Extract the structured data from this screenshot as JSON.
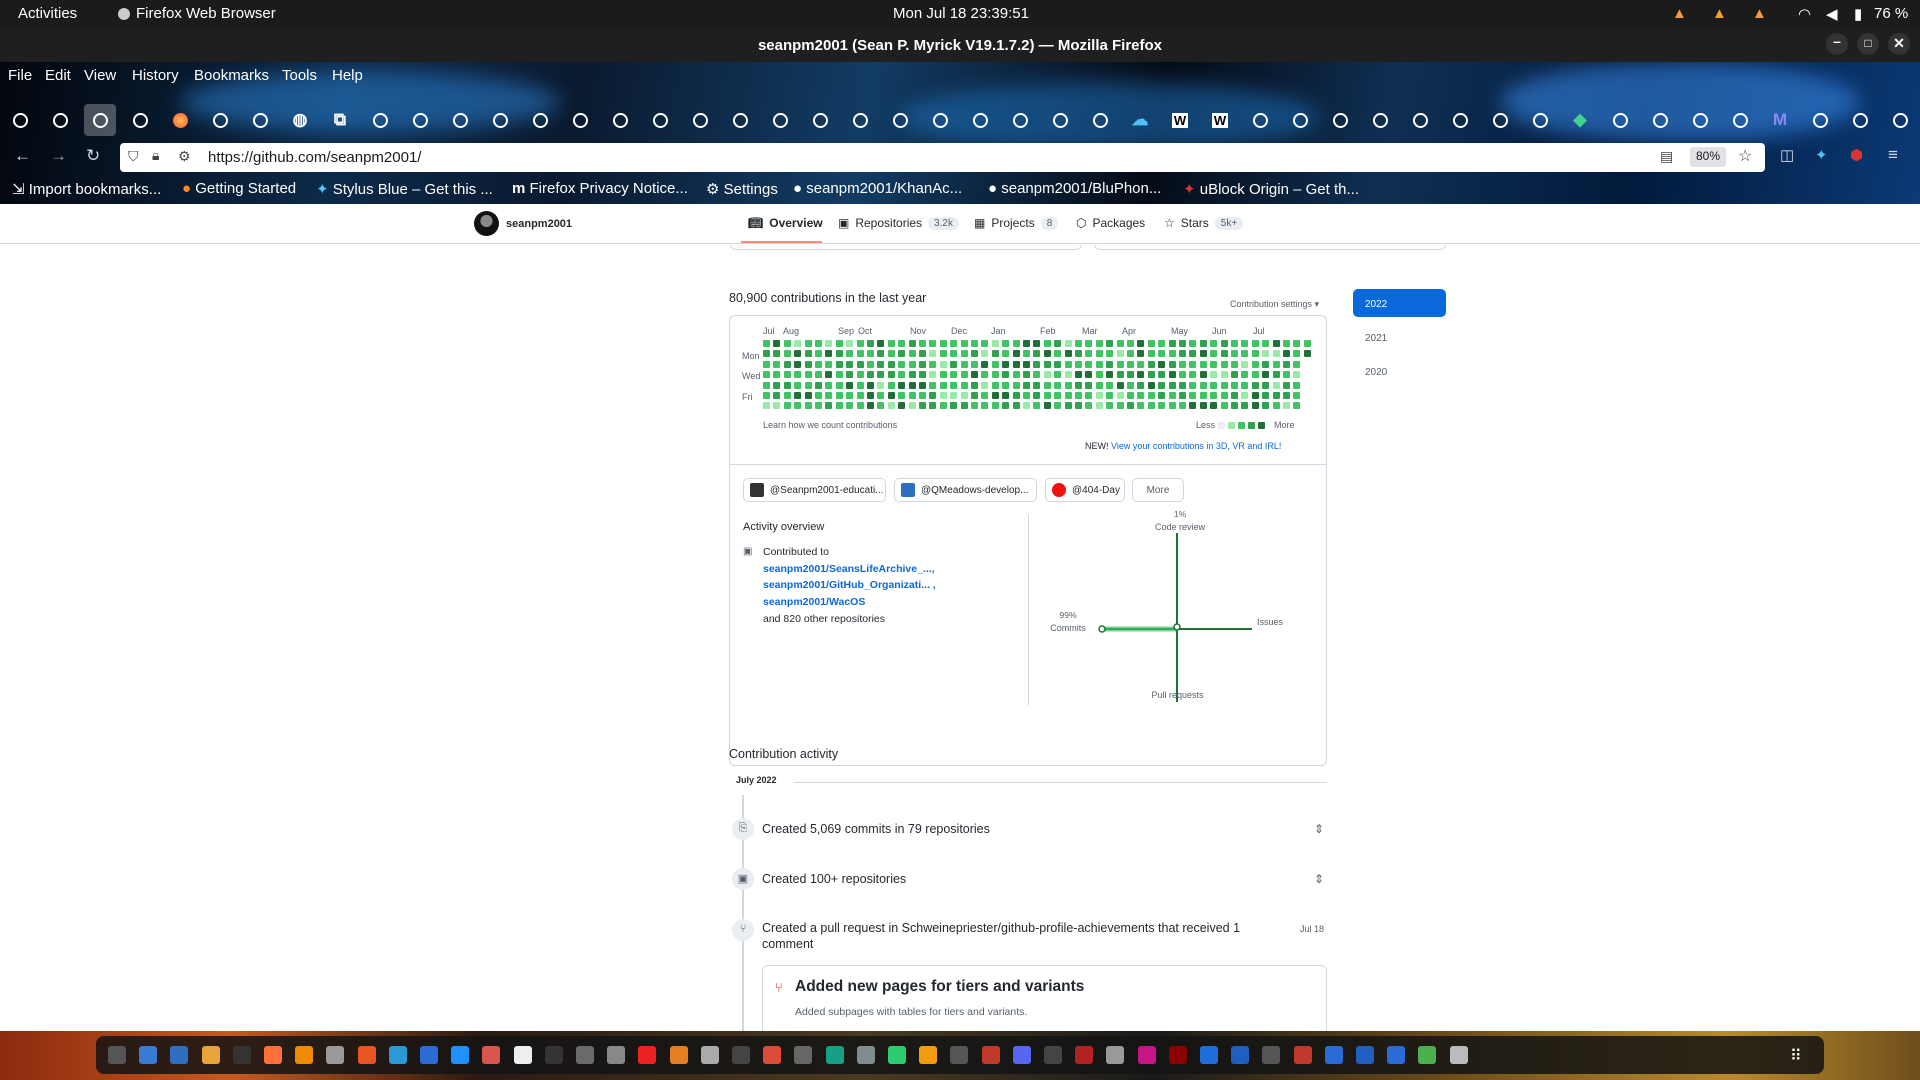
{
  "system": {
    "activities": "Activities",
    "app_name": "Firefox Web Browser",
    "datetime": "Mon Jul 18  23:39:51",
    "battery": "76 %"
  },
  "window": {
    "title": "seanpm2001 (Sean P. Myrick V19.1.7.2) — Mozilla Firefox"
  },
  "menu": [
    "File",
    "Edit",
    "View",
    "History",
    "Bookmarks",
    "Tools",
    "Help"
  ],
  "browser": {
    "url": "https://github.com/seanpm2001/",
    "zoom": "80%",
    "bookmarks": [
      "Import bookmarks...",
      "Getting Started",
      "Stylus Blue – Get this ...",
      "Firefox Privacy Notice...",
      "Settings",
      "seanpm2001/KhanAc...",
      "seanpm2001/BluPhon...",
      "uBlock Origin – Get th..."
    ]
  },
  "profile_nav": {
    "username": "seanpm2001",
    "tabs": [
      {
        "label": "Overview"
      },
      {
        "label": "Repositories",
        "count": "3.2k"
      },
      {
        "label": "Projects",
        "count": "8"
      },
      {
        "label": "Packages"
      },
      {
        "label": "Stars",
        "count": "5k+"
      }
    ]
  },
  "contributions": {
    "heading": "80,900 contributions in the last year",
    "settings": "Contribution settings ▾",
    "months": [
      "Jul",
      "Aug",
      "Sep",
      "Oct",
      "Nov",
      "Dec",
      "Jan",
      "Feb",
      "Mar",
      "Apr",
      "May",
      "Jun",
      "Jul"
    ],
    "days": [
      "Mon",
      "Wed",
      "Fri"
    ],
    "learn": "Learn how we count contributions",
    "less": "Less",
    "more": "More",
    "new_label": "NEW!",
    "new_link": "View your contributions in 3D, VR and IRL!",
    "years": [
      "2022",
      "2021",
      "2020"
    ],
    "palette": [
      "#ebedf0",
      "#9be9a8",
      "#40c463",
      "#30a14e",
      "#216e39"
    ]
  },
  "orgs": {
    "items": [
      "@Seanpm2001-educati...",
      "@QMeadows-develop...",
      "@404-Day"
    ],
    "more": "More"
  },
  "activity_overview": {
    "title": "Activity overview",
    "contributed_to": "Contributed to",
    "repos": [
      "seanpm2001/SeansLifeArchive_...,",
      "seanpm2001/GitHub_Organizati... ,",
      "seanpm2001/WacOS"
    ],
    "others": "and 820 other repositories",
    "axes": {
      "code_review_pct": "1%",
      "code_review": "Code review",
      "commits_pct": "99%",
      "commits": "Commits",
      "issues": "Issues",
      "pull_requests": "Pull requests"
    }
  },
  "activity": {
    "heading": "Contribution activity",
    "month": "July 2022",
    "items": [
      {
        "text": "Created 5,069 commits in 79 repositories"
      },
      {
        "text": "Created 100+ repositories"
      },
      {
        "text": "Created a pull request in Schweinepriester/github-profile-achievements that received 1 comment",
        "date": "Jul 18"
      }
    ],
    "pr_title": "Added new pages for tiers and variants",
    "pr_desc": "Added subpages with tables for tiers and variants."
  }
}
